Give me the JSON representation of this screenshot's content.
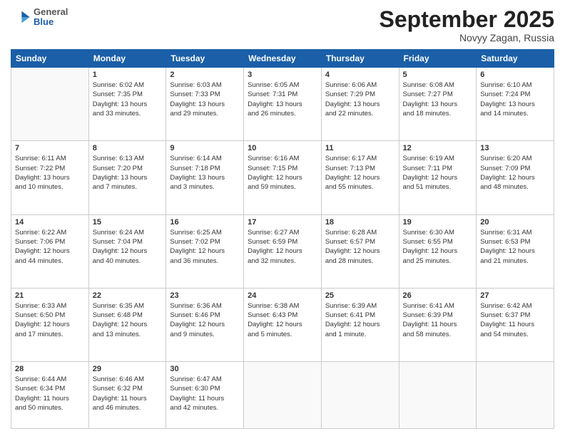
{
  "header": {
    "logo": {
      "general": "General",
      "blue": "Blue"
    },
    "month": "September 2025",
    "location": "Novyy Zagan, Russia"
  },
  "days_of_week": [
    "Sunday",
    "Monday",
    "Tuesday",
    "Wednesday",
    "Thursday",
    "Friday",
    "Saturday"
  ],
  "weeks": [
    [
      {
        "day": "",
        "content": ""
      },
      {
        "day": "1",
        "content": "Sunrise: 6:02 AM\nSunset: 7:35 PM\nDaylight: 13 hours\nand 33 minutes."
      },
      {
        "day": "2",
        "content": "Sunrise: 6:03 AM\nSunset: 7:33 PM\nDaylight: 13 hours\nand 29 minutes."
      },
      {
        "day": "3",
        "content": "Sunrise: 6:05 AM\nSunset: 7:31 PM\nDaylight: 13 hours\nand 26 minutes."
      },
      {
        "day": "4",
        "content": "Sunrise: 6:06 AM\nSunset: 7:29 PM\nDaylight: 13 hours\nand 22 minutes."
      },
      {
        "day": "5",
        "content": "Sunrise: 6:08 AM\nSunset: 7:27 PM\nDaylight: 13 hours\nand 18 minutes."
      },
      {
        "day": "6",
        "content": "Sunrise: 6:10 AM\nSunset: 7:24 PM\nDaylight: 13 hours\nand 14 minutes."
      }
    ],
    [
      {
        "day": "7",
        "content": "Sunrise: 6:11 AM\nSunset: 7:22 PM\nDaylight: 13 hours\nand 10 minutes."
      },
      {
        "day": "8",
        "content": "Sunrise: 6:13 AM\nSunset: 7:20 PM\nDaylight: 13 hours\nand 7 minutes."
      },
      {
        "day": "9",
        "content": "Sunrise: 6:14 AM\nSunset: 7:18 PM\nDaylight: 13 hours\nand 3 minutes."
      },
      {
        "day": "10",
        "content": "Sunrise: 6:16 AM\nSunset: 7:15 PM\nDaylight: 12 hours\nand 59 minutes."
      },
      {
        "day": "11",
        "content": "Sunrise: 6:17 AM\nSunset: 7:13 PM\nDaylight: 12 hours\nand 55 minutes."
      },
      {
        "day": "12",
        "content": "Sunrise: 6:19 AM\nSunset: 7:11 PM\nDaylight: 12 hours\nand 51 minutes."
      },
      {
        "day": "13",
        "content": "Sunrise: 6:20 AM\nSunset: 7:09 PM\nDaylight: 12 hours\nand 48 minutes."
      }
    ],
    [
      {
        "day": "14",
        "content": "Sunrise: 6:22 AM\nSunset: 7:06 PM\nDaylight: 12 hours\nand 44 minutes."
      },
      {
        "day": "15",
        "content": "Sunrise: 6:24 AM\nSunset: 7:04 PM\nDaylight: 12 hours\nand 40 minutes."
      },
      {
        "day": "16",
        "content": "Sunrise: 6:25 AM\nSunset: 7:02 PM\nDaylight: 12 hours\nand 36 minutes."
      },
      {
        "day": "17",
        "content": "Sunrise: 6:27 AM\nSunset: 6:59 PM\nDaylight: 12 hours\nand 32 minutes."
      },
      {
        "day": "18",
        "content": "Sunrise: 6:28 AM\nSunset: 6:57 PM\nDaylight: 12 hours\nand 28 minutes."
      },
      {
        "day": "19",
        "content": "Sunrise: 6:30 AM\nSunset: 6:55 PM\nDaylight: 12 hours\nand 25 minutes."
      },
      {
        "day": "20",
        "content": "Sunrise: 6:31 AM\nSunset: 6:53 PM\nDaylight: 12 hours\nand 21 minutes."
      }
    ],
    [
      {
        "day": "21",
        "content": "Sunrise: 6:33 AM\nSunset: 6:50 PM\nDaylight: 12 hours\nand 17 minutes."
      },
      {
        "day": "22",
        "content": "Sunrise: 6:35 AM\nSunset: 6:48 PM\nDaylight: 12 hours\nand 13 minutes."
      },
      {
        "day": "23",
        "content": "Sunrise: 6:36 AM\nSunset: 6:46 PM\nDaylight: 12 hours\nand 9 minutes."
      },
      {
        "day": "24",
        "content": "Sunrise: 6:38 AM\nSunset: 6:43 PM\nDaylight: 12 hours\nand 5 minutes."
      },
      {
        "day": "25",
        "content": "Sunrise: 6:39 AM\nSunset: 6:41 PM\nDaylight: 12 hours\nand 1 minute."
      },
      {
        "day": "26",
        "content": "Sunrise: 6:41 AM\nSunset: 6:39 PM\nDaylight: 11 hours\nand 58 minutes."
      },
      {
        "day": "27",
        "content": "Sunrise: 6:42 AM\nSunset: 6:37 PM\nDaylight: 11 hours\nand 54 minutes."
      }
    ],
    [
      {
        "day": "28",
        "content": "Sunrise: 6:44 AM\nSunset: 6:34 PM\nDaylight: 11 hours\nand 50 minutes."
      },
      {
        "day": "29",
        "content": "Sunrise: 6:46 AM\nSunset: 6:32 PM\nDaylight: 11 hours\nand 46 minutes."
      },
      {
        "day": "30",
        "content": "Sunrise: 6:47 AM\nSunset: 6:30 PM\nDaylight: 11 hours\nand 42 minutes."
      },
      {
        "day": "",
        "content": ""
      },
      {
        "day": "",
        "content": ""
      },
      {
        "day": "",
        "content": ""
      },
      {
        "day": "",
        "content": ""
      }
    ]
  ]
}
